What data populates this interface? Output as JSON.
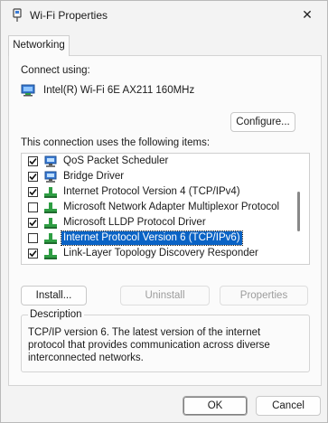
{
  "window": {
    "title": "Wi-Fi Properties",
    "close_glyph": "✕"
  },
  "tabs": [
    {
      "label": "Networking"
    }
  ],
  "connect": {
    "label": "Connect using:",
    "adapter": "Intel(R) Wi-Fi 6E AX211 160MHz",
    "configure_label": "Configure..."
  },
  "items_label": "This connection uses the following items:",
  "items": [
    {
      "label": "QoS Packet Scheduler",
      "checked": true,
      "icon": "network-service-icon"
    },
    {
      "label": "Bridge Driver",
      "checked": true,
      "icon": "network-service-icon"
    },
    {
      "label": "Internet Protocol Version 4 (TCP/IPv4)",
      "checked": true,
      "icon": "protocol-icon"
    },
    {
      "label": "Microsoft Network Adapter Multiplexor Protocol",
      "checked": false,
      "icon": "protocol-icon"
    },
    {
      "label": "Microsoft LLDP Protocol Driver",
      "checked": true,
      "icon": "protocol-icon"
    },
    {
      "label": "Internet Protocol Version 6 (TCP/IPv6)",
      "checked": false,
      "icon": "protocol-icon",
      "selected": true
    },
    {
      "label": "Link-Layer Topology Discovery Responder",
      "checked": true,
      "icon": "protocol-icon"
    }
  ],
  "buttons": {
    "install": "Install...",
    "uninstall": "Uninstall",
    "properties": "Properties"
  },
  "description": {
    "title": "Description",
    "text": "TCP/IP version 6. The latest version of the internet protocol that provides communication across diverse interconnected networks."
  },
  "footer": {
    "ok": "OK",
    "cancel": "Cancel"
  },
  "colors": {
    "selection": "#0a63c5",
    "protocol_icon": "#2f9e44",
    "service_icon": "#3a7bd5"
  }
}
